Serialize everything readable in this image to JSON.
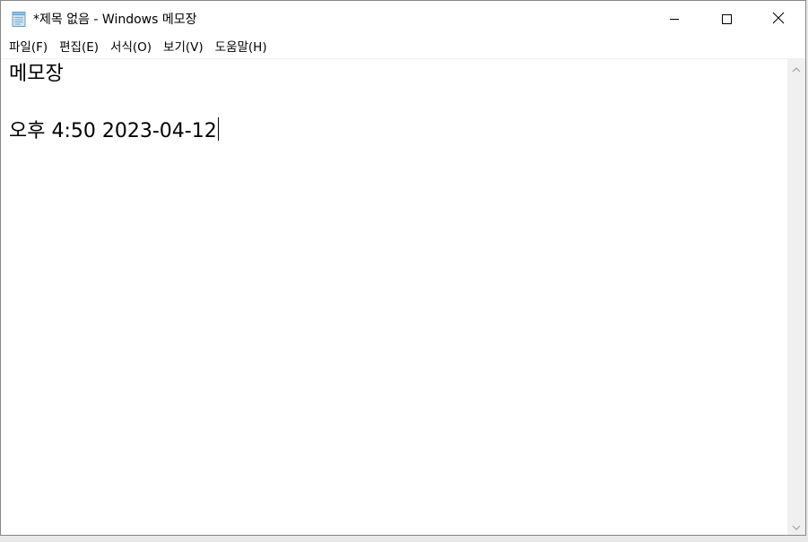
{
  "window": {
    "title": "*제목 없음 - Windows 메모장"
  },
  "icons": {
    "app": "notepad-icon",
    "minimize": "minimize-icon",
    "maximize": "maximize-icon",
    "close": "close-icon",
    "scroll_up": "chevron-up-icon",
    "scroll_down": "chevron-down-icon"
  },
  "menu": {
    "items": [
      {
        "label": "파일(F)"
      },
      {
        "label": "편집(E)"
      },
      {
        "label": "서식(O)"
      },
      {
        "label": "보기(V)"
      },
      {
        "label": "도움말(H)"
      }
    ]
  },
  "editor": {
    "lines": [
      "메모장",
      "",
      "오후 4:50 2023-04-12"
    ]
  },
  "colors": {
    "window_bg": "#ffffff",
    "scrollbar_bg": "#f0f0f0",
    "border": "#888888",
    "text": "#000000"
  }
}
